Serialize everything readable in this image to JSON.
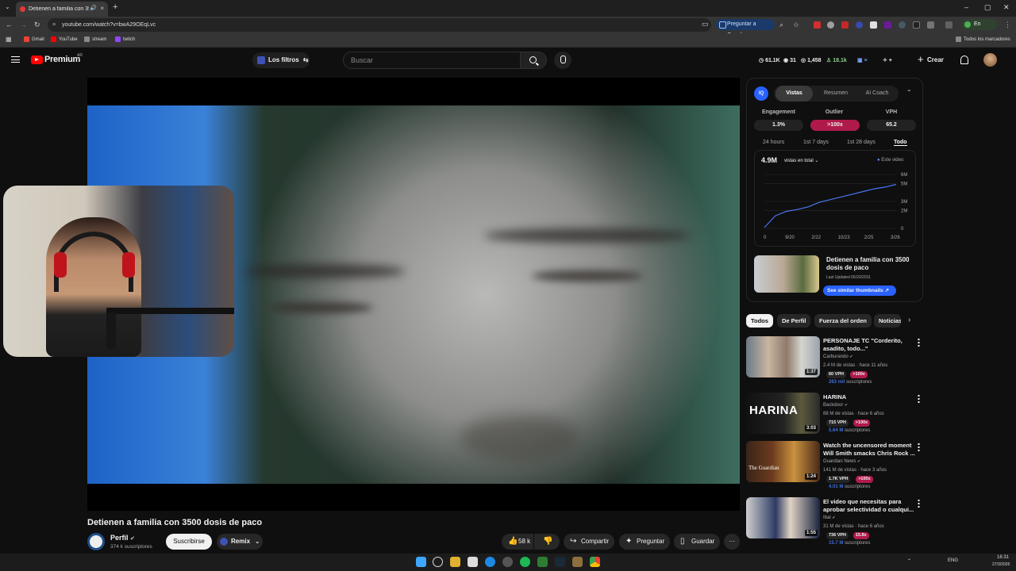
{
  "browser": {
    "tab_title": "Detienen a familia con 3500 dosis de paco",
    "url": "youtube.com/watch?v=bwA29OEqLvc",
    "google_button": "Preguntar a Google",
    "profile_status": "En pausa",
    "bookmarks": [
      "Gmail",
      "YouTube",
      "stream",
      "twitch"
    ],
    "all_bookmarks": "Todos los marcadores"
  },
  "header": {
    "brand": "Premium",
    "region": "AR",
    "filters_label": "Los filtros",
    "search_placeholder": "Buscar",
    "stats": [
      "61.1K",
      "31",
      "1,458",
      "18.1k"
    ],
    "create_label": "Crear"
  },
  "video": {
    "title": "Detienen a familia con 3500 dosis de paco",
    "channel": "Perfil",
    "subscribers": "374 k suscriptores",
    "subscribe_label": "Suscribirse",
    "remix_label": "Remix",
    "likes": "58 k",
    "share_label": "Compartir",
    "ask_label": "Preguntar",
    "save_label": "Guardar"
  },
  "vidiq": {
    "tabs": [
      "Vistas",
      "Resumen",
      "AI Coach"
    ],
    "metrics": [
      {
        "label": "Engagement",
        "value": "1.3%"
      },
      {
        "label": "Outlier",
        "value": ">100x"
      },
      {
        "label": "VPH",
        "value": "65.2"
      }
    ],
    "ranges": [
      "24 hours",
      "1st 7 days",
      "1st 28 days",
      "Todo"
    ],
    "total_views": "4.9M",
    "views_dropdown": "vistas en total",
    "legend": "Este video",
    "thumb_title": "Detienen a familia con 3500 dosis de paco",
    "last_updated": "Last Updated 05/20/2011",
    "similar_label": "See similar thumbnails"
  },
  "chart_data": {
    "type": "line",
    "x_ticks": [
      "0",
      "9/20",
      "2/22",
      "10/23",
      "2/25",
      "3/26"
    ],
    "y_ticks": [
      "6M",
      "5M",
      "3M",
      "2M",
      "0"
    ],
    "series": [
      {
        "name": "Este video",
        "values": [
          0.1,
          1.4,
          1.9,
          2.1,
          2.4,
          2.9,
          3.2,
          3.5,
          3.8,
          4.1,
          4.4,
          4.6,
          4.9
        ]
      }
    ],
    "ylim": [
      0,
      6
    ]
  },
  "chips": [
    "Todos",
    "De Perfil",
    "Fuerza del orden",
    "Noticias"
  ],
  "recommendations": [
    {
      "title": "PERSONAJE TC \"Corderito, asadito, todo...\"",
      "channel": "Carburando",
      "meta": "2.4 M de vistas · hace 11 años",
      "vph": "60 VPH",
      "outlier": ">100x",
      "subs_num": "263 mil",
      "subs_word": "suscriptores",
      "duration": "1:37"
    },
    {
      "title": "HARINA",
      "channel": "Backdoor",
      "meta": "88 M de vistas · hace 6 años",
      "vph": "715 VPH",
      "outlier": ">100x",
      "subs_num": "5.64 M",
      "subs_word": "suscriptores",
      "duration": "3:03",
      "thumb_text": "HARINA"
    },
    {
      "title": "Watch the uncensored moment Will Smith smacks Chris Rock ...",
      "channel": "Guardian News",
      "meta": "141 M de vistas · hace 3 años",
      "vph": "1.7K VPH",
      "outlier": ">100x",
      "subs_num": "4.01 M",
      "subs_word": "suscriptores",
      "duration": "1:24",
      "thumb_text": "The Guardian"
    },
    {
      "title": "El video que necesitas para aprobar selectividad o cualqui...",
      "channel": "Ibai",
      "meta": "31 M de vistas · hace 6 años",
      "vph": "736 VPH",
      "outlier": "15.8x",
      "subs_num": "15.7 M",
      "subs_word": "suscriptores",
      "duration": "1:55"
    }
  ],
  "taskbar": {
    "lang": "ENG",
    "time": "16:31",
    "date": "27/3/2026"
  }
}
